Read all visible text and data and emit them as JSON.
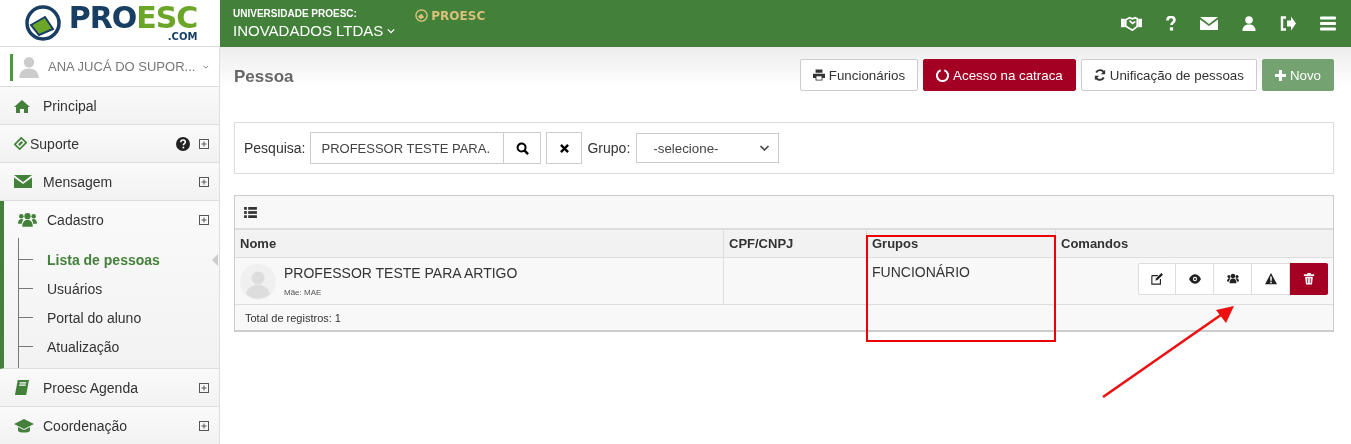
{
  "logo": {
    "dark": "PRO",
    "green": "ESC",
    "domain": ".COM"
  },
  "header": {
    "institution": "UNIVERSIDADE PROESC:",
    "company": "INOVADADOS LTDAS",
    "badge": "PROESC"
  },
  "sidebar": {
    "user": "ANA JUCÁ DO SUPOR...",
    "items": [
      {
        "label": "Principal",
        "expandable": false,
        "help_icon": false,
        "expanded": false
      },
      {
        "label": "Suporte",
        "expandable": true,
        "help_icon": true,
        "expanded": false
      },
      {
        "label": "Mensagem",
        "expandable": true,
        "help_icon": false,
        "expanded": false
      },
      {
        "label": "Cadastro",
        "expandable": true,
        "help_icon": false,
        "expanded": true,
        "children": [
          {
            "label": "Lista de pessoas",
            "selected": true
          },
          {
            "label": "Usuários",
            "selected": false
          },
          {
            "label": "Portal do aluno",
            "selected": false
          },
          {
            "label": "Atualização",
            "selected": false
          }
        ]
      },
      {
        "label": "Proesc Agenda",
        "expandable": true,
        "help_icon": false,
        "expanded": false
      },
      {
        "label": "Coordenação",
        "expandable": true,
        "help_icon": false,
        "expanded": false
      }
    ]
  },
  "page": {
    "title": "Pessoa",
    "actions": [
      {
        "label": "Funcionários",
        "kind": "default"
      },
      {
        "label": "Acesso na catraca",
        "kind": "danger"
      },
      {
        "label": "Unificação de pessoas",
        "kind": "default"
      },
      {
        "label": "Novo",
        "kind": "success"
      }
    ]
  },
  "search": {
    "label": "Pesquisa:",
    "value": "PROFESSOR TESTE PARA.",
    "group_label": "Grupo:",
    "group_value": "-selecione-"
  },
  "table": {
    "columns": [
      "Nome",
      "CPF/CNPJ",
      "Grupos",
      "Comandos"
    ],
    "rows": [
      {
        "name": "PROFESSOR TESTE PARA ARTIGO",
        "mother": "Mãe: MAE",
        "groups": "FUNCIONÁRIO"
      }
    ],
    "total": "Total de registros: 1"
  }
}
